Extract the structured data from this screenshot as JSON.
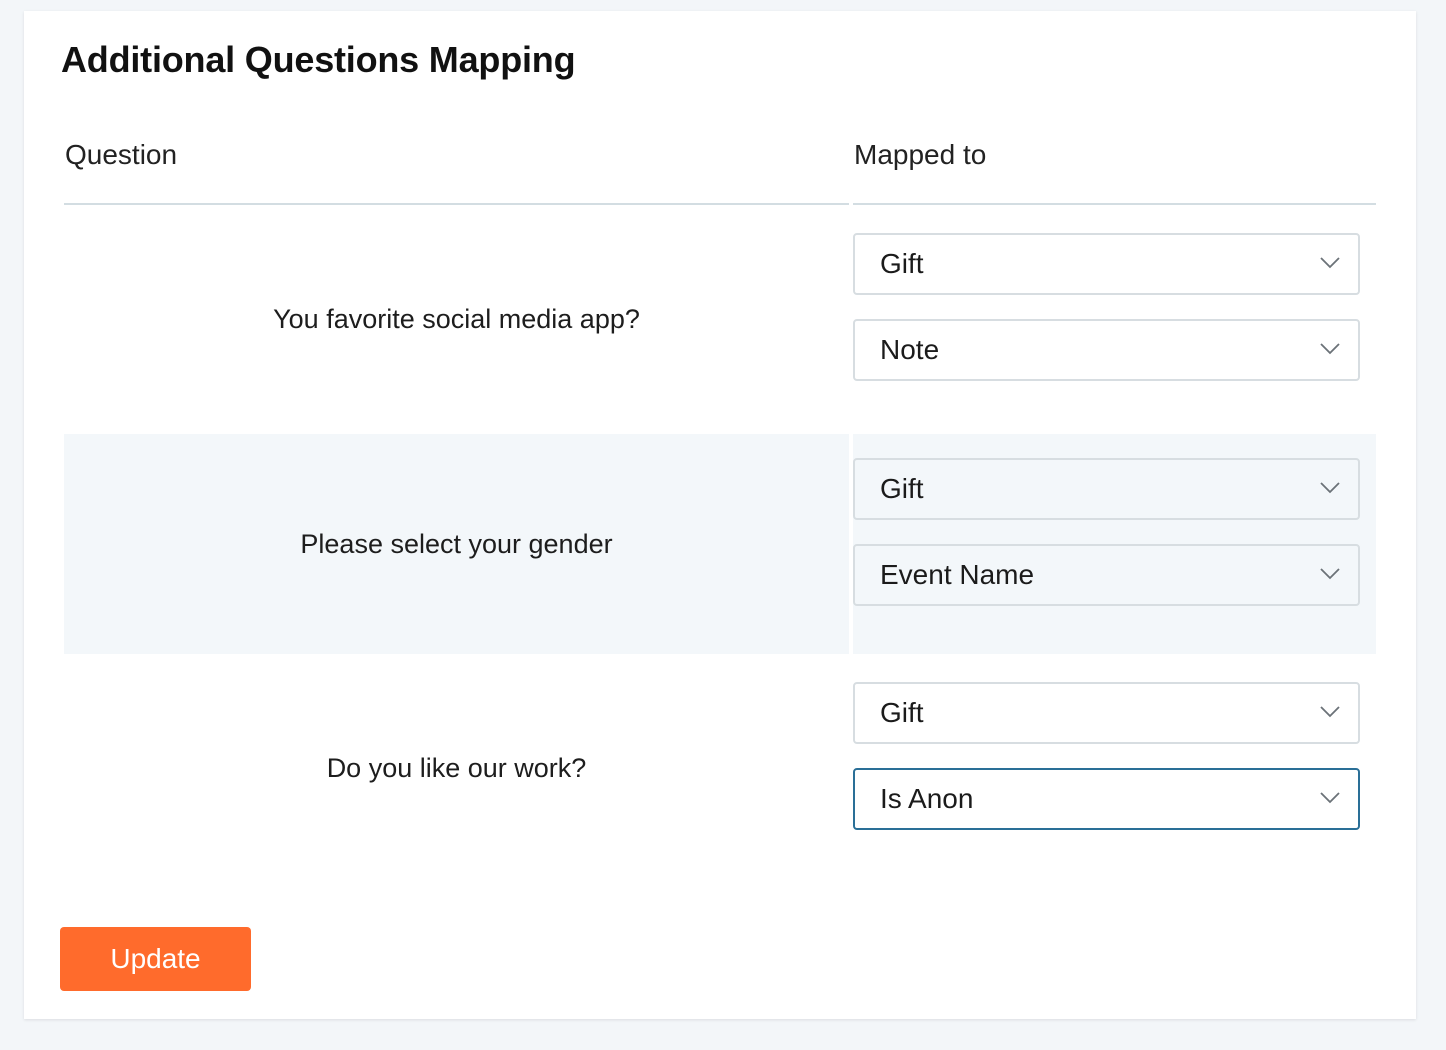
{
  "page": {
    "title": "Additional Questions Mapping"
  },
  "table": {
    "headers": {
      "question": "Question",
      "mapped_to": "Mapped to"
    },
    "rows": [
      {
        "question": "You favorite social media app?",
        "mappings": [
          "Gift",
          "Note"
        ]
      },
      {
        "question": "Please select your gender",
        "mappings": [
          "Gift",
          "Event Name"
        ]
      },
      {
        "question": "Do you like our work?",
        "mappings": [
          "Gift",
          "Is Anon"
        ]
      }
    ]
  },
  "actions": {
    "update_label": "Update"
  },
  "colors": {
    "accent": "#ff6b2c",
    "focus_border": "#2a6f97",
    "alt_row": "#f3f7fa"
  }
}
